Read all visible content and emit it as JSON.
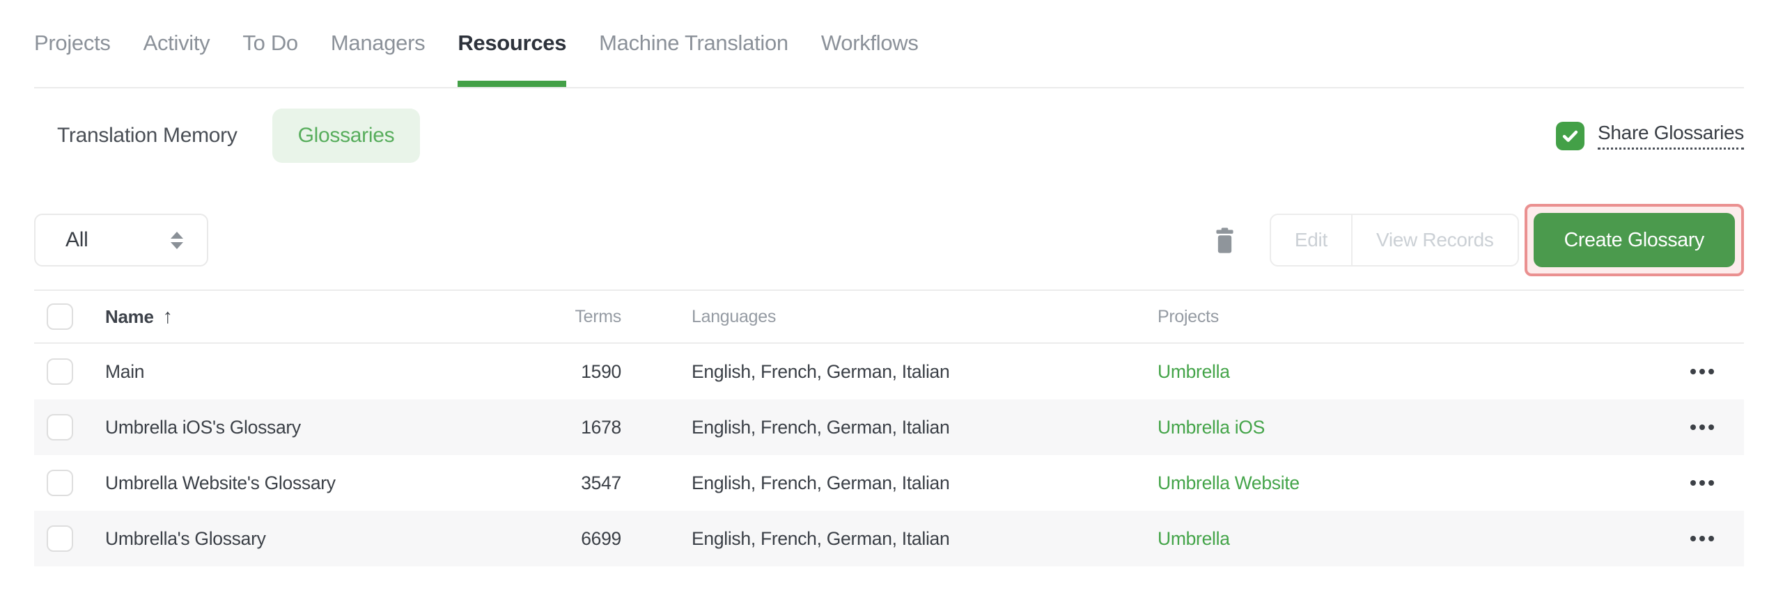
{
  "nav": {
    "tabs": [
      {
        "label": "Projects",
        "active": false
      },
      {
        "label": "Activity",
        "active": false
      },
      {
        "label": "To Do",
        "active": false
      },
      {
        "label": "Managers",
        "active": false
      },
      {
        "label": "Resources",
        "active": true
      },
      {
        "label": "Machine Translation",
        "active": false
      },
      {
        "label": "Workflows",
        "active": false
      }
    ]
  },
  "subnav": {
    "translation_memory_label": "Translation Memory",
    "glossaries_label": "Glossaries",
    "share": {
      "label": "Share Glossaries",
      "checked": true
    }
  },
  "toolbar": {
    "filter_value": "All",
    "edit_label": "Edit",
    "view_records_label": "View Records",
    "create_label": "Create Glossary"
  },
  "table": {
    "headers": {
      "name": "Name",
      "terms": "Terms",
      "languages": "Languages",
      "projects": "Projects"
    },
    "sort_arrow": "↑",
    "sort": {
      "column": "Name",
      "direction": "asc"
    },
    "rows": [
      {
        "name": "Main",
        "terms": "1590",
        "languages": "English, French, German, Italian",
        "project": "Umbrella"
      },
      {
        "name": "Umbrella iOS's Glossary",
        "terms": "1678",
        "languages": "English, French, German, Italian",
        "project": "Umbrella iOS"
      },
      {
        "name": "Umbrella Website's Glossary",
        "terms": "3547",
        "languages": "English, French, German, Italian",
        "project": "Umbrella Website"
      },
      {
        "name": "Umbrella's Glossary",
        "terms": "6699",
        "languages": "English, French, German, Italian",
        "project": "Umbrella"
      }
    ]
  },
  "colors": {
    "accent_green": "#43a047",
    "button_green": "#4b9a4d",
    "pill_bg": "#e9f4e9",
    "pill_text": "#57ad5c",
    "link_green": "#44a449",
    "highlight_border": "#ea9090",
    "highlight_bg": "#fdecec",
    "row_stripe": "#f7f7f8",
    "inactive_tab": "#8b9199",
    "dark_text": "#363b43",
    "muted_header": "#959ba3",
    "disabled_text": "#cbd0d5"
  }
}
